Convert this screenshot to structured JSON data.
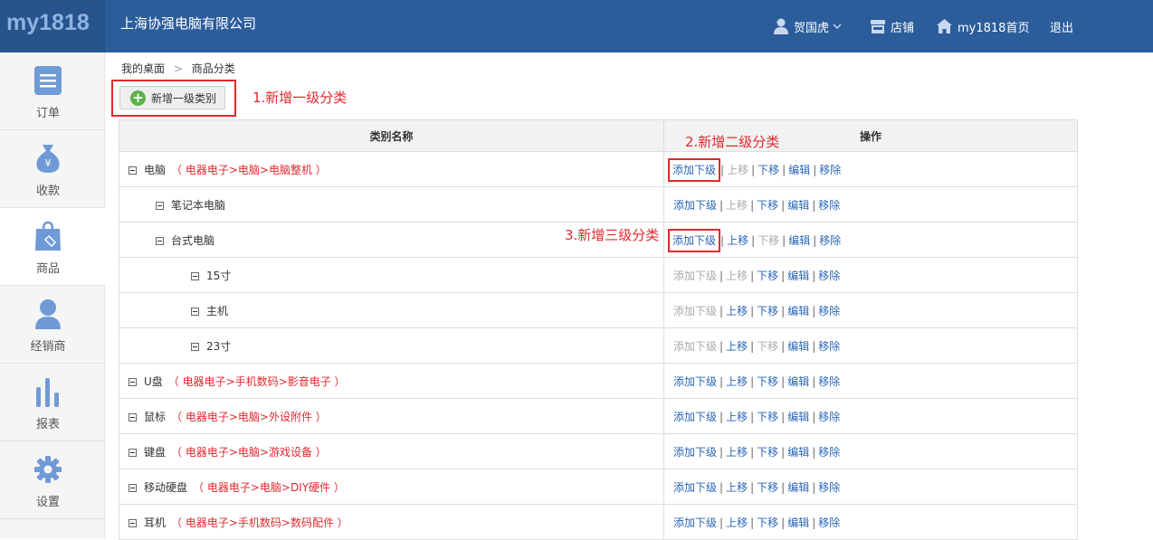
{
  "header": {
    "logo": "my1818",
    "company": "上海协强电脑有限公司",
    "user": "贺国虎",
    "shop": "店铺",
    "home": "my1818首页",
    "logout": "退出"
  },
  "sidebar": {
    "items": [
      {
        "label": "订单",
        "icon": "list-icon"
      },
      {
        "label": "收款",
        "icon": "money-bag-icon"
      },
      {
        "label": "商品",
        "icon": "shopping-bag-icon",
        "active": true
      },
      {
        "label": "经销商",
        "icon": "person-icon"
      },
      {
        "label": "报表",
        "icon": "bar-chart-icon"
      },
      {
        "label": "设置",
        "icon": "gear-icon"
      }
    ]
  },
  "breadcrumb": {
    "home": "我的桌面",
    "sep": ">",
    "current": "商品分类"
  },
  "add_button": "新增一级类别",
  "annotations": {
    "a1": "1.新增一级分类",
    "a2": "2.新增二级分类",
    "a3": "3.新增三级分类"
  },
  "table": {
    "headers": {
      "name": "类别名称",
      "ops": "操作"
    },
    "op_labels": {
      "add": "添加下级",
      "up": "上移",
      "down": "下移",
      "edit": "编辑",
      "remove": "移除"
    },
    "rows": [
      {
        "name": "电脑",
        "path": "（ 电器电子>电脑>电脑整机 ）",
        "level": 1,
        "add": true,
        "up": false,
        "down": true
      },
      {
        "name": "笔记本电脑",
        "path": "",
        "level": 2,
        "add": true,
        "up": false,
        "down": true
      },
      {
        "name": "台式电脑",
        "path": "",
        "level": 2,
        "add": true,
        "up": true,
        "down": false
      },
      {
        "name": "15寸",
        "path": "",
        "level": 3,
        "add": false,
        "up": false,
        "down": true
      },
      {
        "name": "主机",
        "path": "",
        "level": 3,
        "add": false,
        "up": true,
        "down": true
      },
      {
        "name": "23寸",
        "path": "",
        "level": 3,
        "add": false,
        "up": true,
        "down": false
      },
      {
        "name": "U盘",
        "path": "（ 电器电子>手机数码>影音电子 ）",
        "level": 1,
        "add": true,
        "up": true,
        "down": true
      },
      {
        "name": "鼠标",
        "path": "（ 电器电子>电脑>外设附件 ）",
        "level": 1,
        "add": true,
        "up": true,
        "down": true
      },
      {
        "name": "键盘",
        "path": "（ 电器电子>电脑>游戏设备 ）",
        "level": 1,
        "add": true,
        "up": true,
        "down": true
      },
      {
        "name": "移动硬盘",
        "path": "（ 电器电子>电脑>DIY硬件 ）",
        "level": 1,
        "add": true,
        "up": true,
        "down": true
      },
      {
        "name": "耳机",
        "path": "（ 电器电子>手机数码>数码配件 ）",
        "level": 1,
        "add": true,
        "up": true,
        "down": true
      }
    ]
  },
  "colors": {
    "header_bg": "#2c5d9b",
    "accent_red": "#e0292f",
    "link_blue": "#2a66b8",
    "icon_blue": "#6f9ad6"
  }
}
